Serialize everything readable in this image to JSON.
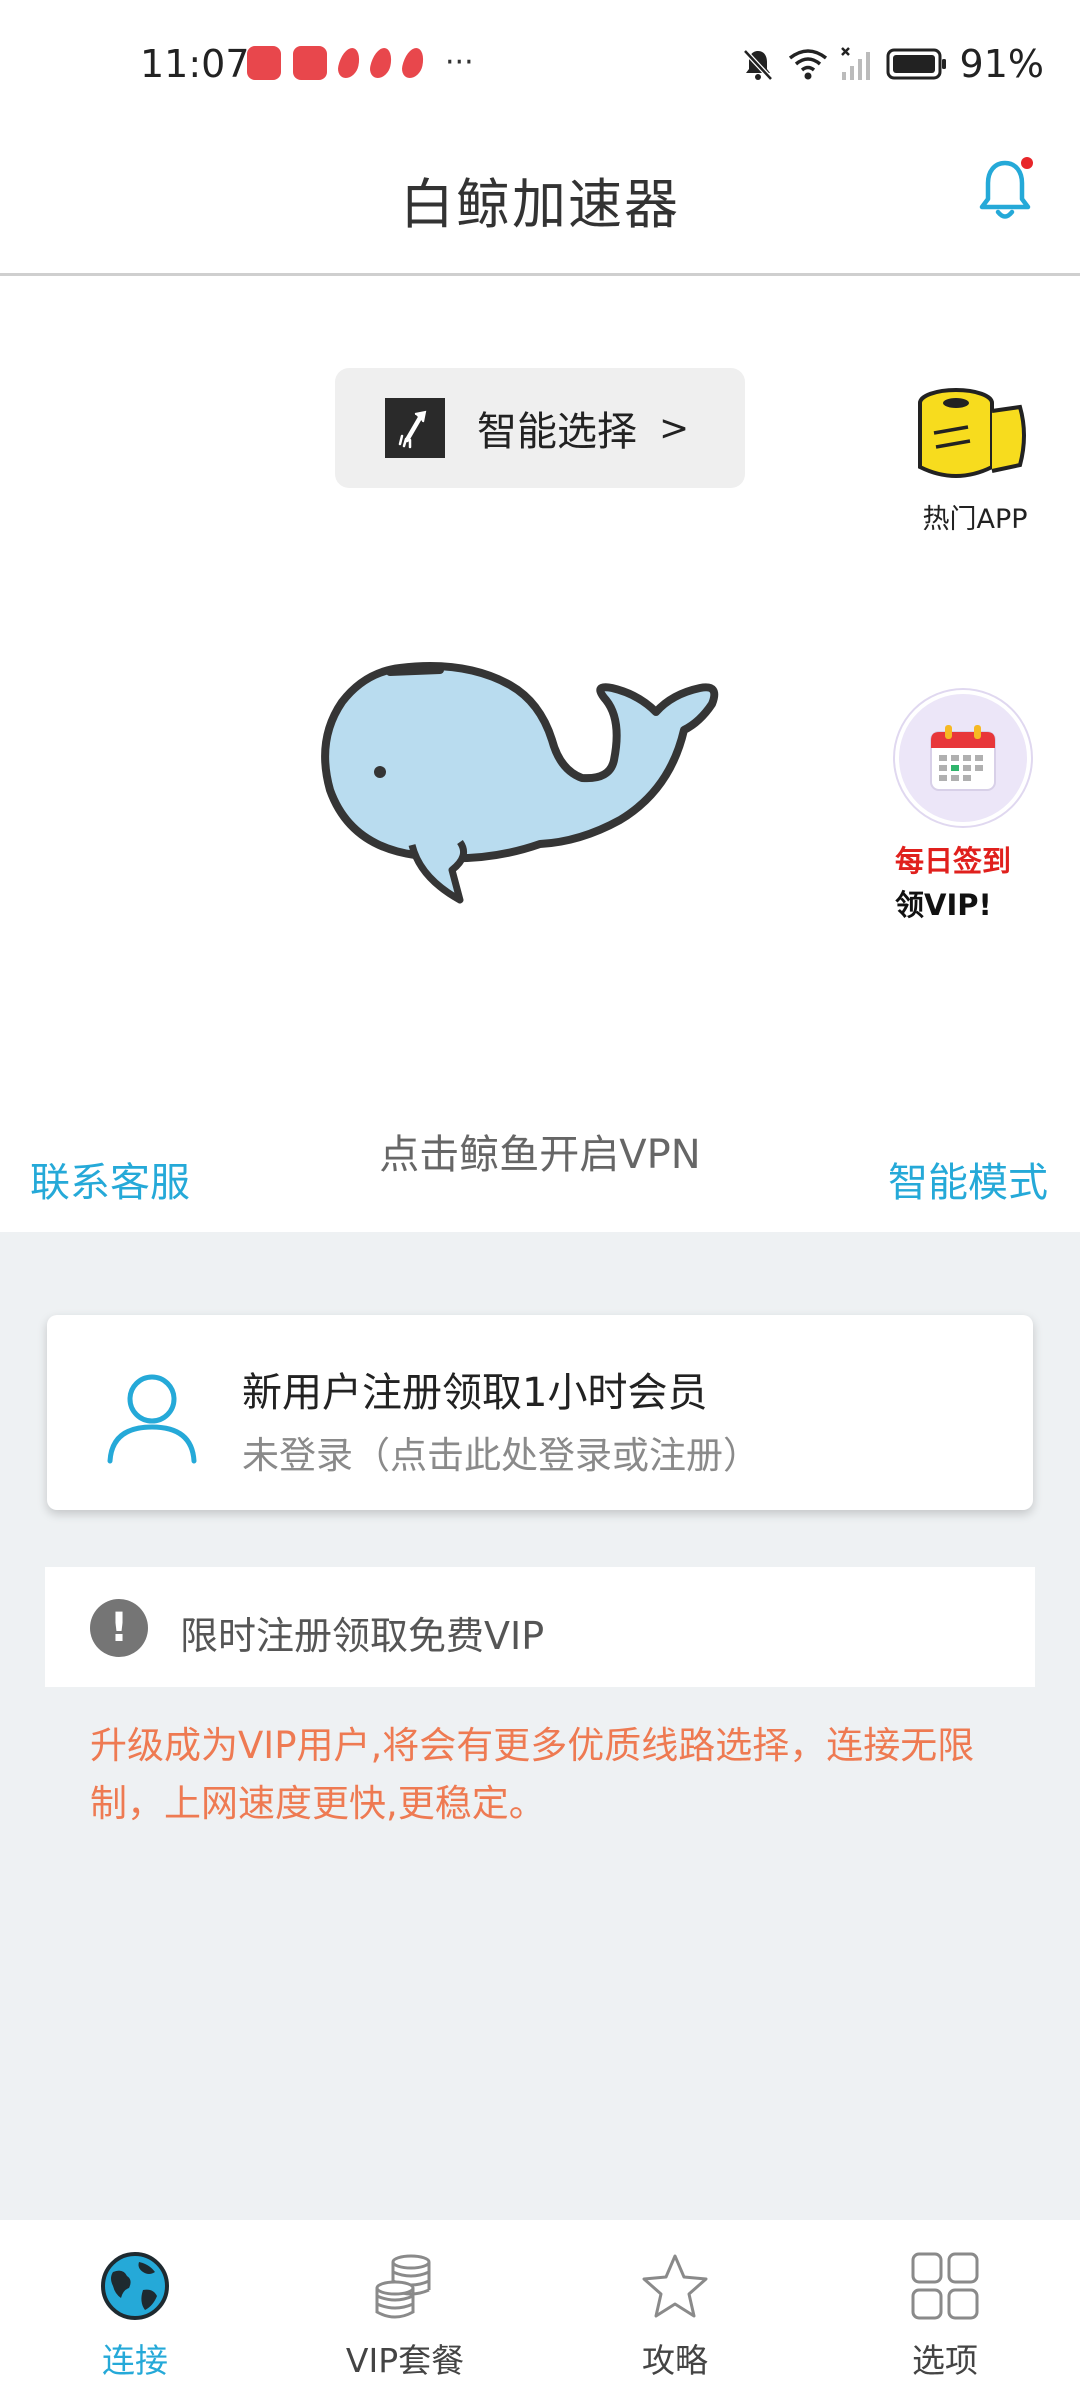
{
  "status_bar": {
    "time": "11:07",
    "more": "···",
    "battery": "91%"
  },
  "header": {
    "title": "白鲸加速器"
  },
  "server": {
    "label": "智能选择",
    "arrow": ">"
  },
  "hot_app": {
    "label": "热门APP"
  },
  "checkin": {
    "line1": "每日签到",
    "line2": "领VIP!"
  },
  "connect": {
    "hint": "点击鲸鱼开启VPN"
  },
  "links": {
    "contact": "联系客服",
    "mode": "智能模式"
  },
  "user_card": {
    "title": "新用户注册领取1小时会员",
    "subtitle": "未登录（点击此处登录或注册）"
  },
  "notice": {
    "icon": "!",
    "text": "限时注册领取免费VIP"
  },
  "promo": {
    "text": "升级成为VIP用户,将会有更多优质线路选择，连接无限制，上网速度更快,更稳定。"
  },
  "tabs": [
    {
      "label": "连接",
      "icon": "globe-icon",
      "active": true
    },
    {
      "label": "VIP套餐",
      "icon": "coins-icon",
      "active": false
    },
    {
      "label": "攻略",
      "icon": "star-icon",
      "active": false
    },
    {
      "label": "选项",
      "icon": "grid-icon",
      "active": false
    }
  ],
  "colors": {
    "accent": "#25a9d8",
    "promo": "#ee7a52",
    "checkin_red": "#e0201d",
    "background_gray": "#eef1f3"
  }
}
